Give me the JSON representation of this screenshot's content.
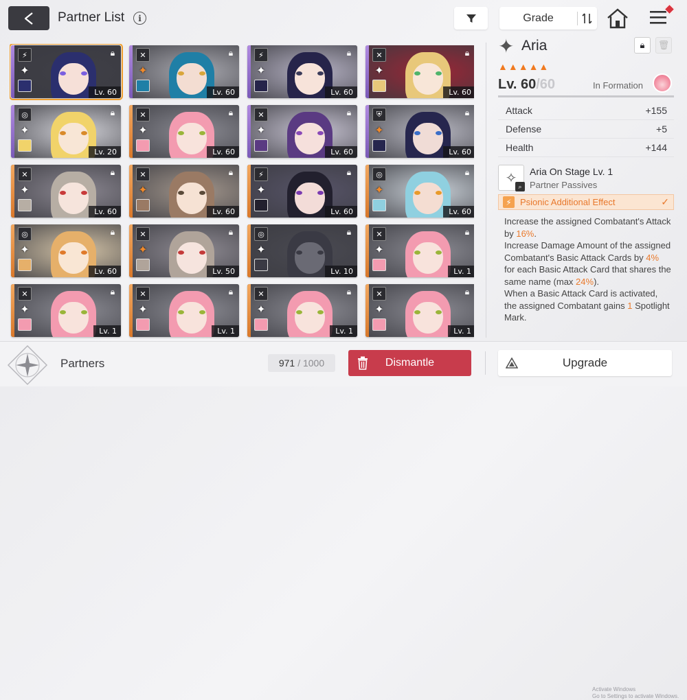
{
  "header": {
    "title": "Partner List",
    "info_icon": "info-icon",
    "grade_label": "Grade"
  },
  "partners": [
    {
      "level": "Lv. 60",
      "type": "bolt",
      "rarity": "purple",
      "orange_shuriken": false,
      "hair": "#2b2f6e",
      "eyes": "#7a5fe0",
      "skin": "#f6e0d8",
      "bg": "#3f3f47",
      "selected": true
    },
    {
      "level": "Lv. 60",
      "type": "cross",
      "rarity": "purple",
      "orange_shuriken": true,
      "hair": "#1f7fa6",
      "eyes": "#d9a63a",
      "skin": "#f3ddd2",
      "bg": "#a9a9b0",
      "selected": false
    },
    {
      "level": "Lv. 60",
      "type": "bolt",
      "rarity": "purple",
      "orange_shuriken": false,
      "hair": "#26244a",
      "eyes": "#3b3b5a",
      "skin": "#f7e3da",
      "bg": "#b6b2c4",
      "selected": false
    },
    {
      "level": "Lv. 60",
      "type": "cross",
      "rarity": "purple",
      "orange_shuriken": false,
      "hair": "#e8c87a",
      "eyes": "#4fb46a",
      "skin": "#f8e6d8",
      "bg": "#9b2636",
      "selected": false
    },
    {
      "level": "Lv. 20",
      "type": "target",
      "rarity": "purple",
      "orange_shuriken": false,
      "hair": "#f1d36a",
      "eyes": "#d98a2a",
      "skin": "#f8e6d6",
      "bg": "#cfcfd5",
      "selected": false
    },
    {
      "level": "Lv. 60",
      "type": "cross",
      "rarity": "orange",
      "orange_shuriken": false,
      "hair": "#f39bb0",
      "eyes": "#9ab53a",
      "skin": "#f8e3dc",
      "bg": "#8a8a92",
      "selected": false
    },
    {
      "level": "Lv. 60",
      "type": "cross",
      "rarity": "purple",
      "orange_shuriken": false,
      "hair": "#5a3a82",
      "eyes": "#8a4ab8",
      "skin": "#f6e0dc",
      "bg": "#c7c3d2",
      "selected": false
    },
    {
      "level": "Lv. 60",
      "type": "shield",
      "rarity": "purple",
      "orange_shuriken": true,
      "hair": "#26264e",
      "eyes": "#3a6ec8",
      "skin": "#f0dcd6",
      "bg": "#b8b8c2",
      "selected": false
    },
    {
      "level": "Lv. 60",
      "type": "cross",
      "rarity": "orange",
      "orange_shuriken": false,
      "hair": "#b7aea4",
      "eyes": "#c83a3a",
      "skin": "#f6e4dc",
      "bg": "#8a8690",
      "selected": false
    },
    {
      "level": "Lv. 60",
      "type": "cross",
      "rarity": "orange",
      "orange_shuriken": true,
      "hair": "#9a7a64",
      "eyes": "#5a4a3a",
      "skin": "#f6e2d4",
      "bg": "#a2968c",
      "selected": false
    },
    {
      "level": "Lv. 60",
      "type": "bolt",
      "rarity": "orange",
      "orange_shuriken": false,
      "hair": "#22202e",
      "eyes": "#7a3ab0",
      "skin": "#f3dcd8",
      "bg": "#575468",
      "selected": false
    },
    {
      "level": "Lv. 60",
      "type": "target",
      "rarity": "orange",
      "orange_shuriken": true,
      "hair": "#8fd0e0",
      "eyes": "#e89a2a",
      "skin": "#f4ddd2",
      "bg": "#c8cfd6",
      "selected": false
    },
    {
      "level": "Lv. 60",
      "type": "target",
      "rarity": "orange",
      "orange_shuriken": false,
      "hair": "#e6b06a",
      "eyes": "#e07a2a",
      "skin": "#f9e6d4",
      "bg": "#d2c2a6",
      "selected": false
    },
    {
      "level": "Lv. 50",
      "type": "cross",
      "rarity": "orange",
      "orange_shuriken": true,
      "hair": "#b0a49a",
      "eyes": "#c43a3a",
      "skin": "#f6e4de",
      "bg": "#8e8a92",
      "selected": false
    },
    {
      "level": "Lv. 10",
      "type": "target",
      "rarity": "orange",
      "orange_shuriken": false,
      "hair": "#3a3a44",
      "eyes": "#3a3a44",
      "skin": "#6a6a74",
      "bg": "#4a4a52",
      "selected": false
    },
    {
      "level": "Lv. 1",
      "type": "cross",
      "rarity": "orange",
      "orange_shuriken": false,
      "hair": "#f39bb0",
      "eyes": "#9ab53a",
      "skin": "#f8e3dc",
      "bg": "#8a8a92",
      "selected": false
    },
    {
      "level": "Lv. 1",
      "type": "cross",
      "rarity": "orange",
      "orange_shuriken": false,
      "hair": "#f39bb0",
      "eyes": "#9ab53a",
      "skin": "#f8e3dc",
      "bg": "#8a8a92",
      "selected": false
    },
    {
      "level": "Lv. 1",
      "type": "cross",
      "rarity": "orange",
      "orange_shuriken": false,
      "hair": "#f39bb0",
      "eyes": "#9ab53a",
      "skin": "#f8e3dc",
      "bg": "#8a8a92",
      "selected": false
    },
    {
      "level": "Lv. 1",
      "type": "cross",
      "rarity": "orange",
      "orange_shuriken": false,
      "hair": "#f39bb0",
      "eyes": "#9ab53a",
      "skin": "#f8e3dc",
      "bg": "#8a8a92",
      "selected": false
    },
    {
      "level": "Lv. 1",
      "type": "cross",
      "rarity": "orange",
      "orange_shuriken": false,
      "hair": "#f39bb0",
      "eyes": "#9ab53a",
      "skin": "#f8e3dc",
      "bg": "#8a8a92",
      "selected": false
    }
  ],
  "detail": {
    "name": "Aria",
    "stars": "▲▲▲▲▲",
    "level": "Lv. 60",
    "level_max": "/60",
    "formation_label": "In Formation",
    "stats": [
      {
        "label": "Attack",
        "value": "+155"
      },
      {
        "label": "Defense",
        "value": "+5"
      },
      {
        "label": "Health",
        "value": "+144"
      }
    ],
    "passive_name": "Aria On Stage Lv. 1",
    "passive_sub": "Partner Passives",
    "effect_label": "Psionic Additional Effect",
    "desc_1a": "Increase the assigned Combatant's Attack by ",
    "desc_1b": "16%",
    "desc_1c": ".",
    "desc_2a": "Increase Damage Amount of the assigned Combatant's Basic Attack Cards by ",
    "desc_2b": "4%",
    "desc_2c": " for each Basic Attack Card that shares the same name (max ",
    "desc_2d": "24%",
    "desc_2e": ").",
    "desc_3a": "When a Basic Attack Card is activated, the assigned Combatant gains ",
    "desc_3b": "1",
    "desc_3c": " Spotlight Mark."
  },
  "footer": {
    "partners_label": "Partners",
    "count": "971",
    "count_total": "/ 1000",
    "dismantle_label": "Dismantle",
    "upgrade_label": "Upgrade",
    "watermark_1": "Activate Windows",
    "watermark_2": "Go to Settings to activate Windows."
  },
  "colors": {
    "accent_orange": "#e8782c",
    "dismantle_red": "#c83c4c",
    "selected_border": "#f0a030"
  }
}
